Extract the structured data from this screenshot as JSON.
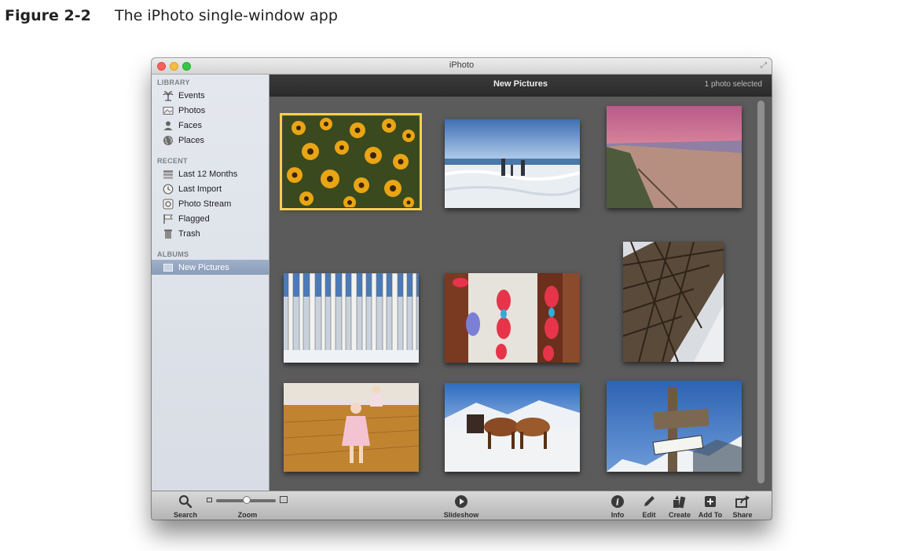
{
  "caption": {
    "number": "Figure 2-2",
    "text": "The iPhoto single-window app"
  },
  "window": {
    "title": "iPhoto"
  },
  "sidebar": {
    "library": {
      "heading": "LIBRARY",
      "items": [
        {
          "label": "Events",
          "icon": "palm-tree-icon"
        },
        {
          "label": "Photos",
          "icon": "photo-icon"
        },
        {
          "label": "Faces",
          "icon": "person-icon"
        },
        {
          "label": "Places",
          "icon": "globe-icon"
        }
      ]
    },
    "recent": {
      "heading": "RECENT",
      "items": [
        {
          "label": "Last 12 Months",
          "icon": "calendar-stack-icon"
        },
        {
          "label": "Last Import",
          "icon": "clock-icon"
        },
        {
          "label": "Photo Stream",
          "icon": "photo-stream-icon"
        },
        {
          "label": "Flagged",
          "icon": "flag-icon"
        },
        {
          "label": "Trash",
          "icon": "trash-icon"
        }
      ]
    },
    "albums": {
      "heading": "ALBUMS",
      "items": [
        {
          "label": "New Pictures",
          "icon": "album-icon",
          "selected": true
        }
      ]
    }
  },
  "main": {
    "title": "New Pictures",
    "selection_status": "1 photo selected",
    "photos": [
      {
        "subject": "sunflowers",
        "selected": true
      },
      {
        "subject": "beach-family"
      },
      {
        "subject": "sunset-beach"
      },
      {
        "subject": "aspen-trees"
      },
      {
        "subject": "fish-decorations"
      },
      {
        "subject": "eiffel-tower"
      },
      {
        "subject": "girl-dancing"
      },
      {
        "subject": "horse-sleigh"
      },
      {
        "subject": "ride-with-boudy-sign"
      }
    ]
  },
  "toolbar": {
    "search_label": "Search",
    "zoom_label": "Zoom",
    "zoom_level": 0.45,
    "slideshow_label": "Slideshow",
    "info_label": "Info",
    "edit_label": "Edit",
    "create_label": "Create",
    "add_to_label": "Add To",
    "share_label": "Share"
  },
  "colors": {
    "selection_outline": "#f3d24a",
    "main_background": "#5b5b5b",
    "header_background": "#2f2f2f",
    "sidebar_selected": "#8a9cb8"
  }
}
